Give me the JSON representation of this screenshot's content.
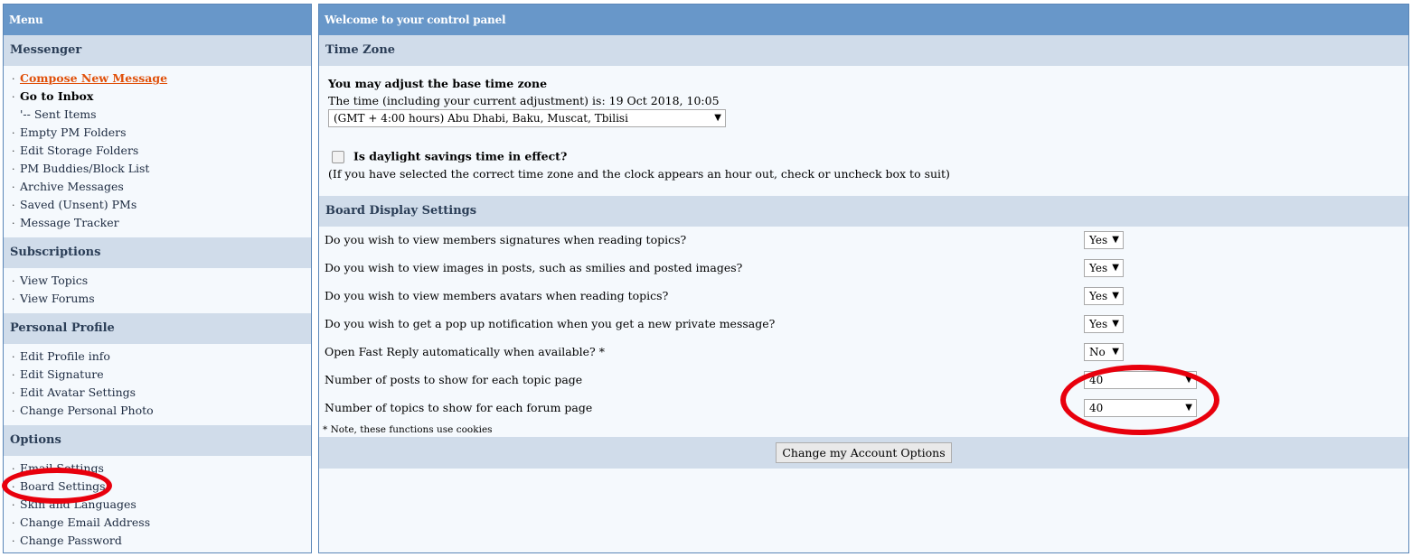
{
  "menu": {
    "title": "Menu",
    "sections": [
      {
        "heading": "Messenger",
        "items": [
          "Compose New Message",
          "Go to Inbox",
          "'-- Sent Items",
          "Empty PM Folders",
          "Edit Storage Folders",
          "PM Buddies/Block List",
          "Archive Messages",
          "Saved (Unsent) PMs",
          "Message Tracker"
        ]
      },
      {
        "heading": "Subscriptions",
        "items": [
          "View Topics",
          "View Forums"
        ]
      },
      {
        "heading": "Personal Profile",
        "items": [
          "Edit Profile info",
          "Edit Signature",
          "Edit Avatar Settings",
          "Change Personal Photo"
        ]
      },
      {
        "heading": "Options",
        "items": [
          "Email Settings",
          "Board Settings",
          "Skin and Languages",
          "Change Email Address",
          "Change Password"
        ]
      }
    ]
  },
  "main": {
    "title": "Welcome to your control panel",
    "timezone": {
      "heading": "Time Zone",
      "adjust_label": "You may adjust the base time zone",
      "time_text": "The time (including your current adjustment) is: 19 Oct 2018, 10:05",
      "selected_zone": "(GMT + 4:00 hours) Abu Dhabi, Baku, Muscat, Tbilisi",
      "dst_label": "Is daylight savings time in effect?",
      "dst_note": "(If you have selected the correct time zone and the clock appears an hour out, check or uncheck box to suit)"
    },
    "board": {
      "heading": "Board Display Settings",
      "options": [
        {
          "question": "Do you wish to view members signatures when reading topics?",
          "value": "Yes"
        },
        {
          "question": "Do you wish to view images in posts, such as smilies and posted images?",
          "value": "Yes"
        },
        {
          "question": "Do you wish to view members avatars when reading topics?",
          "value": "Yes"
        },
        {
          "question": "Do you wish to get a pop up notification when you get a new private message?",
          "value": "Yes"
        },
        {
          "question": "Open Fast Reply automatically when available? *",
          "value": "No"
        },
        {
          "question": "Number of posts to show for each topic page",
          "value": "40"
        },
        {
          "question": "Number of topics to show for each forum page",
          "value": "40"
        }
      ],
      "note": "* Note, these functions use cookies",
      "submit_label": "Change my Account Options"
    }
  },
  "annotation_color": "#e8000d"
}
